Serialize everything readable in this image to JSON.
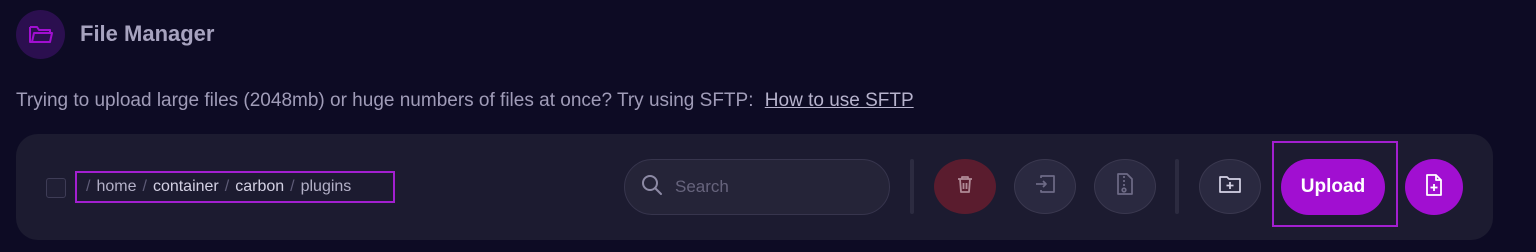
{
  "header": {
    "title": "File Manager",
    "icon": "folder-icon"
  },
  "notice": {
    "text": "Trying to upload large files (2048mb) or huge numbers of files at once? Try using SFTP:",
    "link": "How to use SFTP"
  },
  "breadcrumb": {
    "separator": "/",
    "parts": [
      "home",
      "container",
      "carbon",
      "plugins"
    ]
  },
  "search": {
    "placeholder": "Search"
  },
  "actions": {
    "delete_icon": "trash-icon",
    "move_icon": "move-file-icon",
    "archive_icon": "archive-file-icon",
    "new_folder_icon": "folder-plus-icon",
    "upload_label": "Upload",
    "new_file_icon": "file-plus-icon"
  },
  "colors": {
    "background": "#0d0b24",
    "toolbar": "#1c1b30",
    "accent": "#a10fd1",
    "danger": "#5a1c2e",
    "highlight_border": "#a21fd0"
  }
}
